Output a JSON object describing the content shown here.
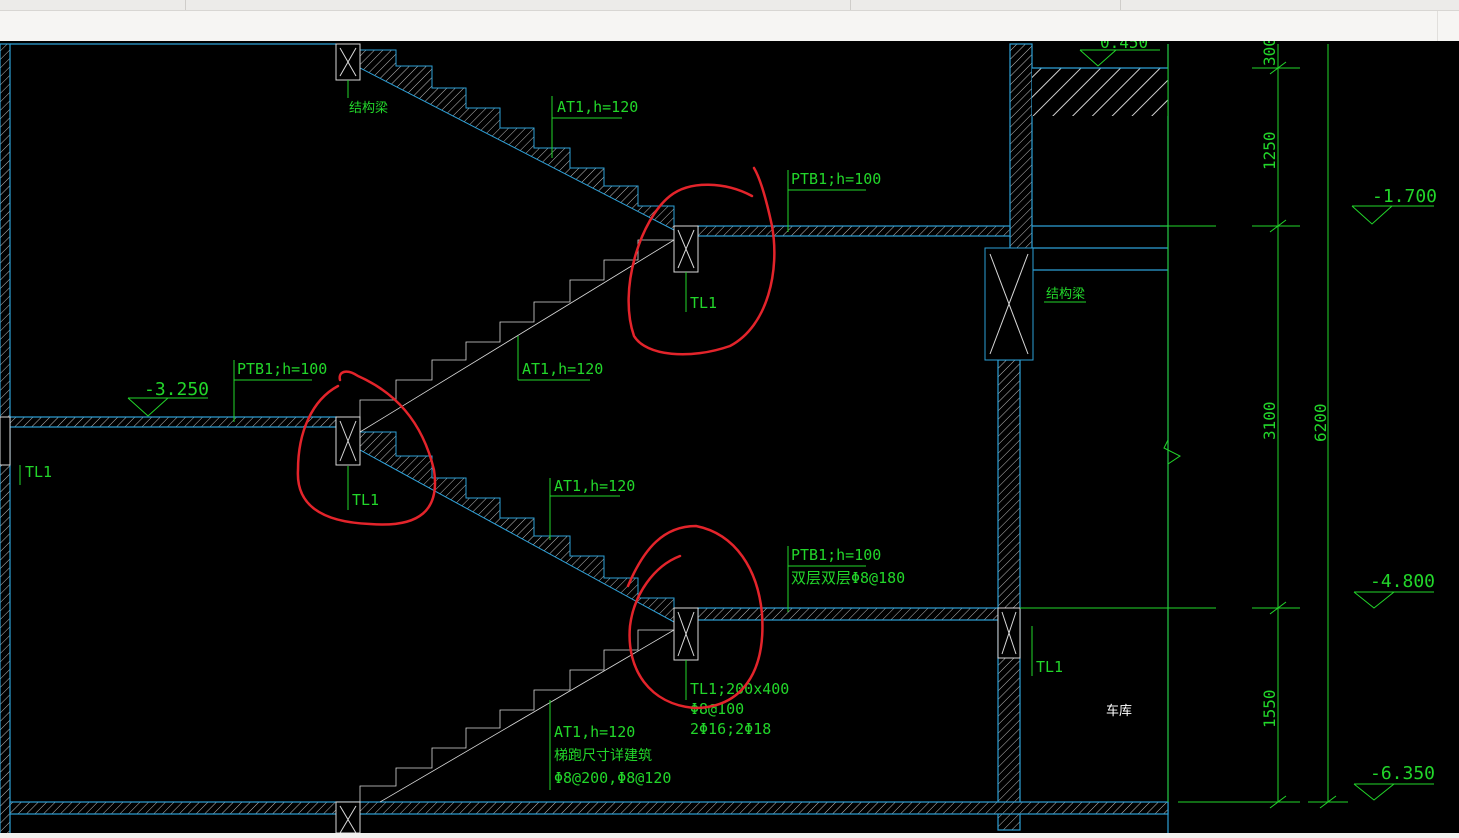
{
  "labels": {
    "structural_beam": "结构梁",
    "at1_h120": "AT1,h=120",
    "ptb1_h100": "PTB1;h=100",
    "tl1": "TL1",
    "ptb1_bot_line1": "PTB1;h=100",
    "ptb1_bot_line2": "双层双层Φ8@180",
    "tl1_bot_line1": "TL1;200x400",
    "tl1_bot_line2": "Φ8@100",
    "tl1_bot_line3": "2Φ16;2Φ18",
    "at1_bot_line1": "AT1,h=120",
    "at1_bot_line2": "梯跑尺寸详建筑",
    "at1_bot_line3": "Φ8@200,Φ8@120",
    "garage": "车库"
  },
  "elevations": {
    "top_partial": "0.450",
    "e1": "-1.700",
    "e2": "-3.250",
    "e3": "-4.800",
    "e4": "-6.350"
  },
  "dimensions": {
    "d300": "300",
    "d1250": "1250",
    "d3100": "3100",
    "d6200": "6200",
    "d1550": "1550"
  },
  "colors": {
    "background": "#000000",
    "structure": "#2d9fd6",
    "annotation": "#22d62a",
    "markup": "#e3242b",
    "detail": "#d9d9d9"
  }
}
